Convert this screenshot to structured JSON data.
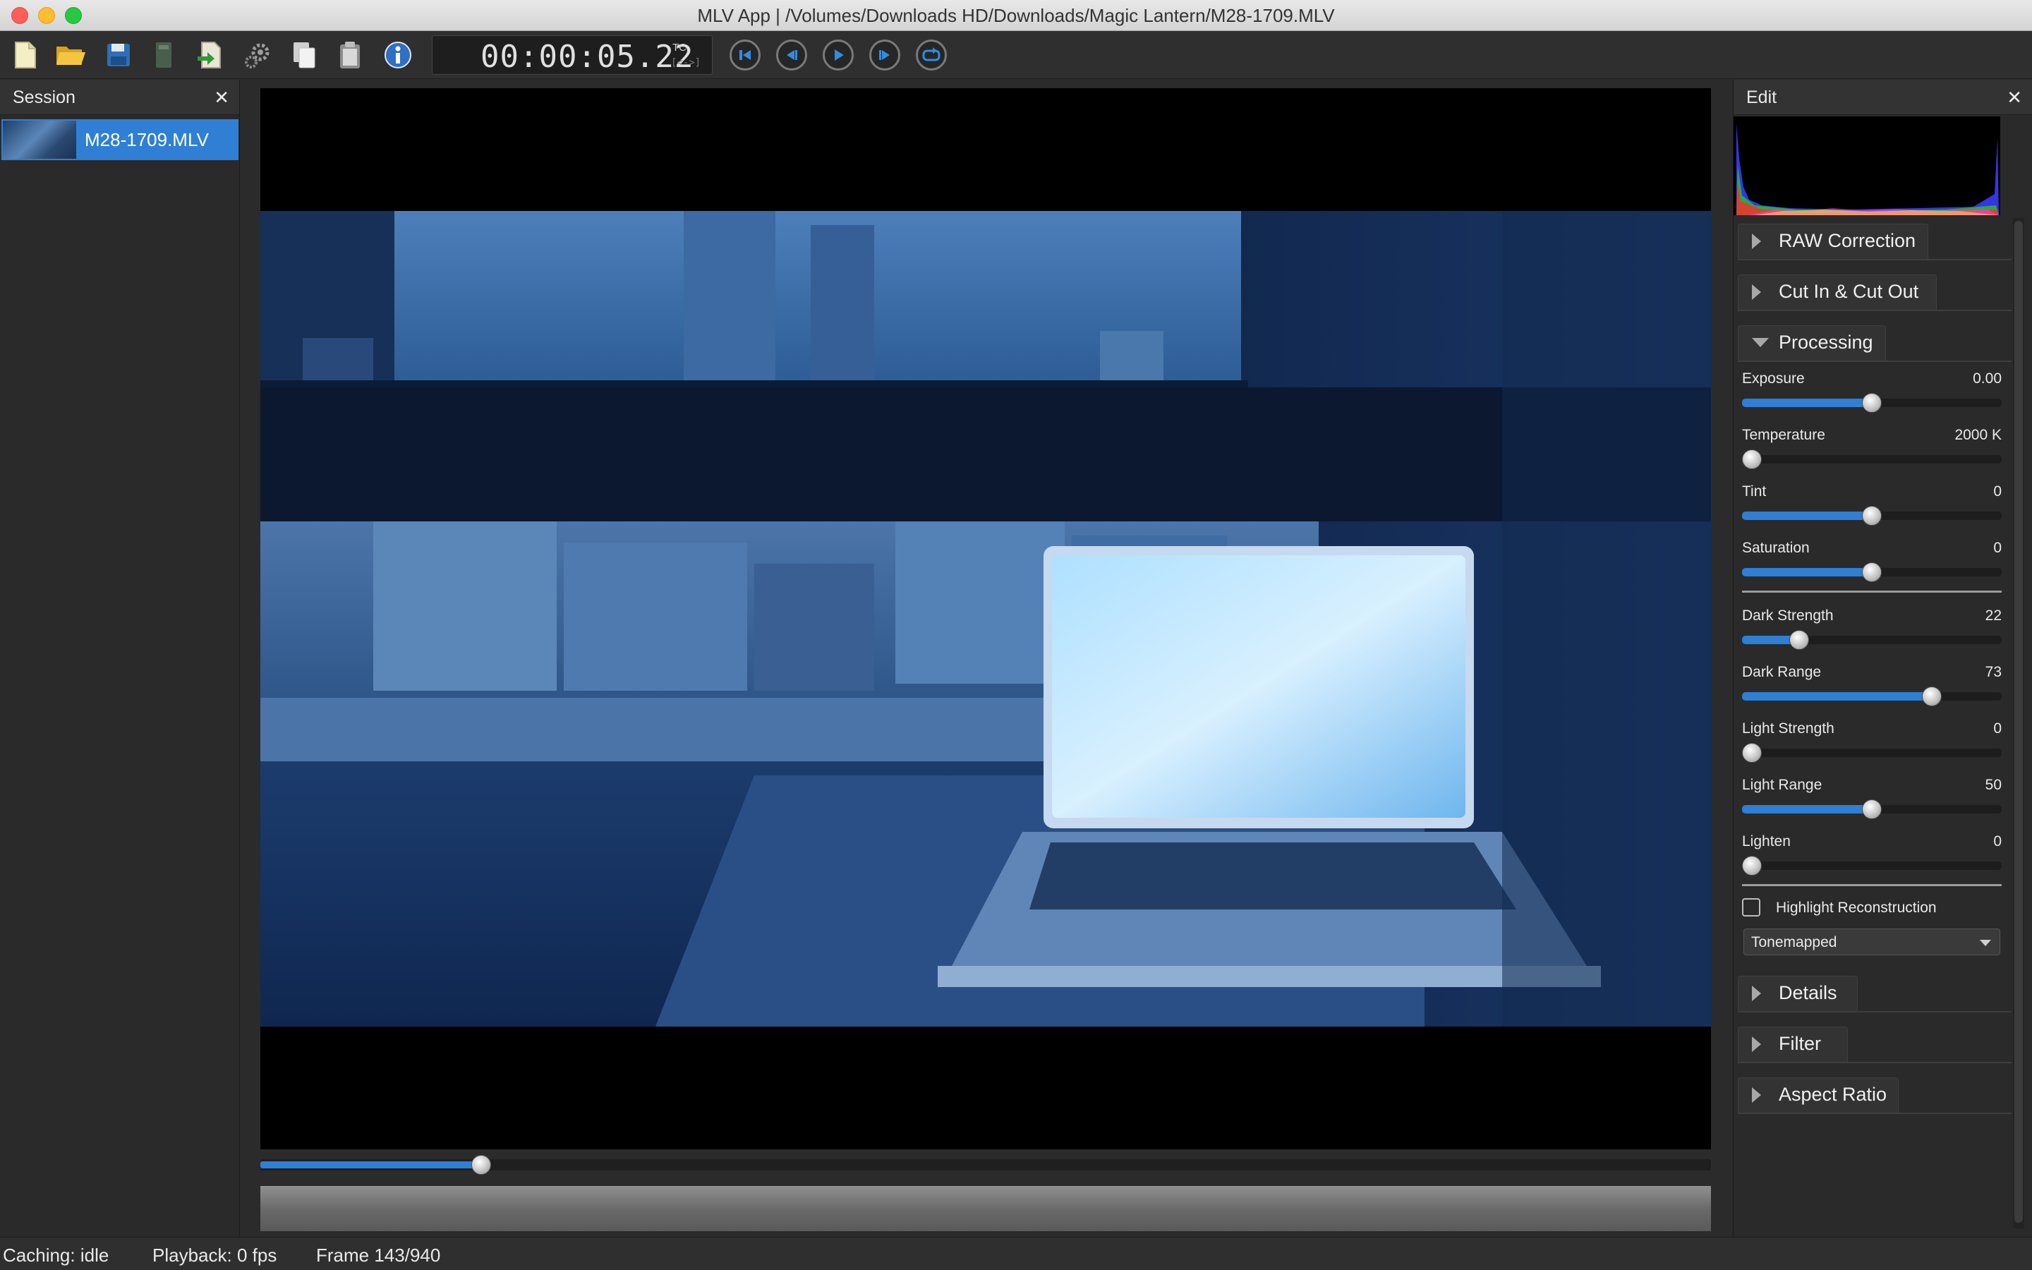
{
  "window": {
    "title": "MLV App | /Volumes/Downloads HD/Downloads/Magic Lantern/M28-1709.MLV"
  },
  "toolbar": {
    "icons": [
      "new-session-icon",
      "open-folder-icon",
      "save-icon",
      "save-as-icon",
      "export-icon",
      "settings-gear-icon",
      "copy-icon",
      "paste-icon",
      "info-icon"
    ],
    "timecode": "00:00:05.22",
    "timecode_label": "TC",
    "timecode_sub": "[<->]",
    "playback_buttons": [
      "jump-first-icon",
      "step-back-icon",
      "play-icon",
      "step-forward-icon",
      "loop-icon"
    ]
  },
  "colors": {
    "accent": "#2f7fd4",
    "panel_bg": "#2a2a2a",
    "viewer_bg": "#000000"
  },
  "session": {
    "header": "Session",
    "close": "✕",
    "clips": [
      {
        "name": "M28-1709.MLV",
        "selected": true
      }
    ]
  },
  "viewer": {
    "timeline_progress": 0.1521
  },
  "edit": {
    "header": "Edit",
    "close": "✕",
    "sections": {
      "raw_correction": "RAW Correction",
      "cut_in_out": "Cut In & Cut Out",
      "processing": "Processing",
      "details": "Details",
      "filter": "Filter",
      "aspect_ratio": "Aspect Ratio"
    },
    "sliders": [
      {
        "label": "Exposure",
        "value": "0.00",
        "fraction": 0.5
      },
      {
        "label": "Temperature",
        "value": "2000 K",
        "fraction": 0.0
      },
      {
        "label": "Tint",
        "value": "0",
        "fraction": 0.5
      },
      {
        "label": "Saturation",
        "value": "0",
        "fraction": 0.5
      },
      {
        "label": "Dark Strength",
        "value": "22",
        "fraction": 0.22
      },
      {
        "label": "Dark Range",
        "value": "73",
        "fraction": 0.73
      },
      {
        "label": "Light Strength",
        "value": "0",
        "fraction": 0.0
      },
      {
        "label": "Light Range",
        "value": "50",
        "fraction": 0.5
      },
      {
        "label": "Lighten",
        "value": "0",
        "fraction": 0.0
      }
    ],
    "highlight_reconstruction": {
      "label": "Highlight Reconstruction",
      "checked": false
    },
    "tonemap_dropdown": {
      "value": "Tonemapped"
    }
  },
  "status": {
    "caching": "Caching: idle",
    "playback": "Playback: 0 fps",
    "frame": "Frame 143/940"
  }
}
